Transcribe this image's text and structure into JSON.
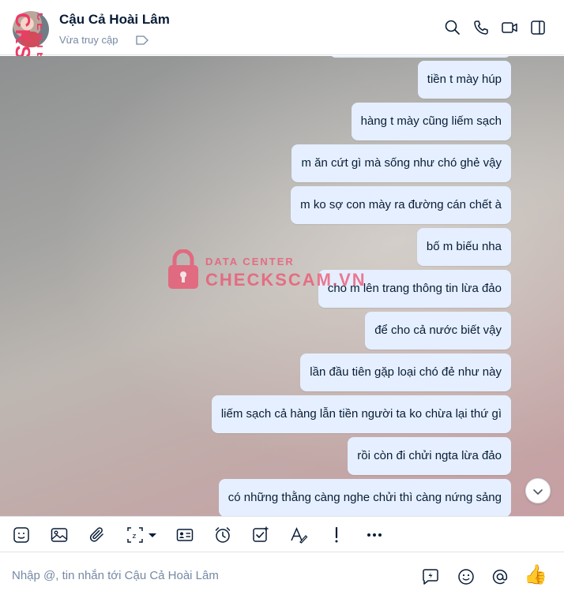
{
  "header": {
    "contact_name": "Cậu Cả Hoài Lâm",
    "status": "Vừa truy cập",
    "icons": [
      "search-icon",
      "phone-icon",
      "video-icon",
      "sidebar-toggle-icon",
      "tag-icon"
    ]
  },
  "messages": [
    {
      "text": "tiền t mày húp"
    },
    {
      "text": "hàng t mày cũng liếm sạch"
    },
    {
      "text": "m ăn cứt gì mà sống như chó ghẻ vậy"
    },
    {
      "text": "m ko sợ con mày ra đường cán chết à"
    },
    {
      "text": "bố m biếu nha"
    },
    {
      "text": "cho m lên trang thông tin lừa đảo"
    },
    {
      "text": "để cho cả nước biết vậy"
    },
    {
      "text": "lần đầu tiên gặp loại chó đẻ như này"
    },
    {
      "text": "liếm sạch cả hàng lẫn tiền người ta ko chừa lại thứ gì"
    },
    {
      "text": "rồi còn đi chửi ngta lừa đảo"
    },
    {
      "text": "có những thằng càng nghe chửi thì càng nứng sảng"
    }
  ],
  "watermark": {
    "line1": "DATA CENTER",
    "line2": "CHECKSCAM.VN",
    "side_large": "CKSCAM.VN",
    "side_small": "CENTER"
  },
  "toolbar": {
    "icons": [
      "sticker-icon",
      "image-icon",
      "attachment-icon",
      "screenshot-icon",
      "chevron-down-icon",
      "business-card-icon",
      "reminder-icon",
      "task-icon",
      "text-format-icon",
      "urgent-icon",
      "more-icon"
    ]
  },
  "composer": {
    "placeholder": "Nhập @, tin nhắn tới Cậu Cả Hoài Lâm",
    "icons": [
      "quick-reply-icon",
      "emoji-icon",
      "mention-icon",
      "thumbs-up-icon"
    ],
    "like_emoji": "👍"
  },
  "colors": {
    "bubble": "#e5efff",
    "accent": "#0068ff",
    "watermark": "#ee3a66"
  }
}
